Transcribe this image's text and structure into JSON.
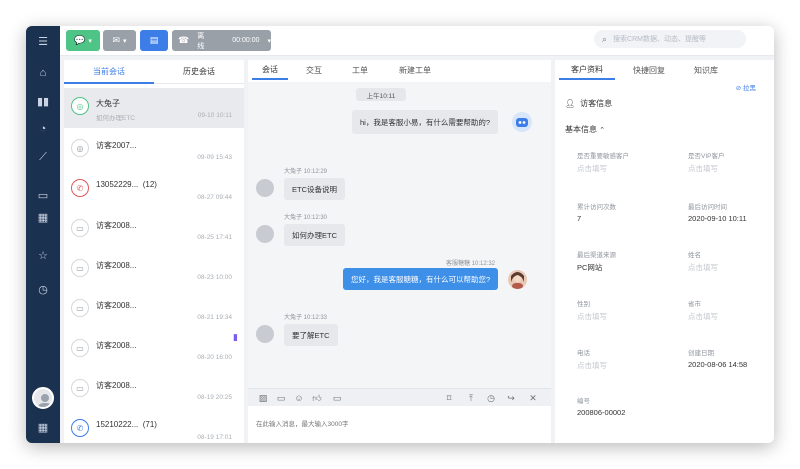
{
  "topbar": {
    "status_label": "离线",
    "timer": "00:00:00",
    "search_placeholder": "搜索CRM数据、动态、提醒等"
  },
  "sessions": {
    "tabs": [
      "当前会话",
      "历史会话"
    ],
    "items": [
      {
        "name": "大兔子",
        "sub": "如何办理ETC",
        "time": "09-10 10:11"
      },
      {
        "name": "访客2007...",
        "sub": "",
        "time": "09-09 15:43"
      },
      {
        "name": "13052229...",
        "count": "(12)",
        "time": "08-27 09:44"
      },
      {
        "name": "访客2008...",
        "time": "08-25 17:41"
      },
      {
        "name": "访客2008...",
        "time": "08-23 10:00"
      },
      {
        "name": "访客2008...",
        "time": "08-21 19:34"
      },
      {
        "name": "访客2008...",
        "time": "08-20 16:00"
      },
      {
        "name": "访客2008...",
        "time": "08-19 20:25"
      },
      {
        "name": "15210222...",
        "count": "(71)",
        "time": "08-19 17:01"
      }
    ]
  },
  "chat": {
    "tabs": [
      "会话",
      "交互",
      "工单",
      "新建工单"
    ],
    "time_divider": "上午10:11",
    "messages": [
      {
        "side": "right-bot",
        "text": "hi，我是客服小易，有什么需要帮助的?"
      },
      {
        "side": "left",
        "meta": "大兔子 10:12:29",
        "text": "ETC设备说明"
      },
      {
        "side": "left",
        "meta": "大兔子 10:12:30",
        "text": "如何办理ETC"
      },
      {
        "side": "right",
        "meta": "客服糖糖 10:12:32",
        "text": "您好，我是客服糖糖，有什么可以帮助您?"
      },
      {
        "side": "left",
        "meta": "大兔子 10:12:33",
        "text": "要了解ETC"
      }
    ],
    "input_placeholder": "在此输入消息，最大输入3000字"
  },
  "profile": {
    "tabs": [
      "客户资料",
      "快捷回复",
      "知识库"
    ],
    "link": "⊘ 拉黑",
    "section_title": "访客信息",
    "group_title": "基本信息",
    "placeholder": "点击填写",
    "fields": [
      {
        "label": "是否重要敏感客户",
        "value": ""
      },
      {
        "label": "是否VIP客户",
        "value": ""
      },
      {
        "label": "累计访问次数",
        "value": "7"
      },
      {
        "label": "最后访问时间",
        "value": "2020-09-10 10:11"
      },
      {
        "label": "最后渠道来源",
        "value": "PC网站"
      },
      {
        "label": "姓名",
        "value": ""
      },
      {
        "label": "性别",
        "value": ""
      },
      {
        "label": "省市",
        "value": ""
      },
      {
        "label": "电话",
        "value": ""
      },
      {
        "label": "创建日期",
        "value": "2020-08-06 14:58"
      },
      {
        "label": "编号",
        "value": "200806-00002"
      }
    ]
  },
  "colors": {
    "rail": "#1b3150",
    "accent": "#3d7de8",
    "chat_btn": "#4fc487",
    "out_bubble": "#3d8fe8"
  }
}
